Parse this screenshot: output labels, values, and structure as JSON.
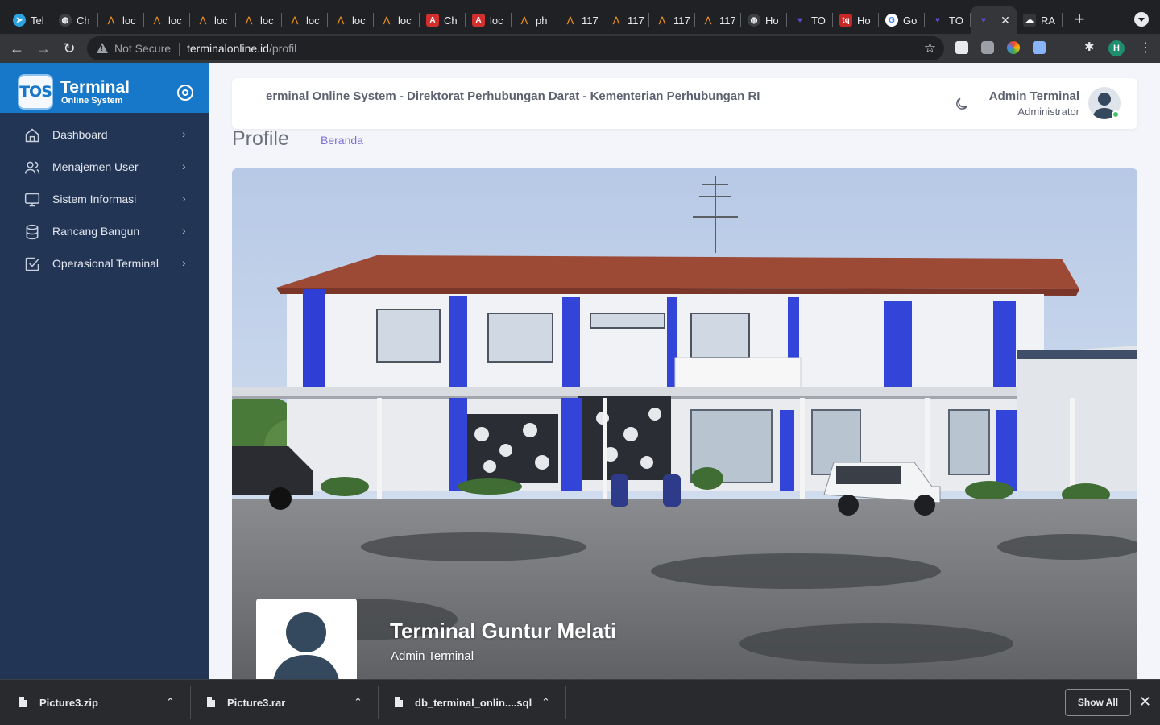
{
  "browser": {
    "tabs": [
      {
        "title": "Tel",
        "icon": "telegram-icon",
        "color": "#2aa3e0",
        "glyph": "➤"
      },
      {
        "title": "Ch",
        "icon": "globe-icon",
        "color": "#3c4043",
        "glyph": "◍"
      },
      {
        "title": "loc",
        "icon": "laragon-icon",
        "color": "#e08a1e",
        "glyph": "⋀"
      },
      {
        "title": "loc",
        "icon": "laragon-icon",
        "color": "#e08a1e",
        "glyph": "⋀"
      },
      {
        "title": "loc",
        "icon": "laragon-icon",
        "color": "#e08a1e",
        "glyph": "⋀"
      },
      {
        "title": "loc",
        "icon": "laragon-icon",
        "color": "#e08a1e",
        "glyph": "⋀"
      },
      {
        "title": "loc",
        "icon": "laragon-icon",
        "color": "#e08a1e",
        "glyph": "⋀"
      },
      {
        "title": "loc",
        "icon": "laragon-icon",
        "color": "#e08a1e",
        "glyph": "⋀"
      },
      {
        "title": "loc",
        "icon": "laragon-icon",
        "color": "#e08a1e",
        "glyph": "⋀"
      },
      {
        "title": "Ch",
        "icon": "angular-icon",
        "color": "#d32f2f",
        "glyph": "A"
      },
      {
        "title": "loc",
        "icon": "angular-icon",
        "color": "#d32f2f",
        "glyph": "A"
      },
      {
        "title": "ph",
        "icon": "laragon-icon",
        "color": "#e08a1e",
        "glyph": "⋀"
      },
      {
        "title": "117",
        "icon": "laragon-icon",
        "color": "#e08a1e",
        "glyph": "⋀"
      },
      {
        "title": "117",
        "icon": "laragon-icon",
        "color": "#e08a1e",
        "glyph": "⋀"
      },
      {
        "title": "117",
        "icon": "laragon-icon",
        "color": "#e08a1e",
        "glyph": "⋀"
      },
      {
        "title": "117",
        "icon": "laragon-icon",
        "color": "#e08a1e",
        "glyph": "⋀"
      },
      {
        "title": "Ho",
        "icon": "globe-icon",
        "color": "#3c4043",
        "glyph": "◍"
      },
      {
        "title": "TO",
        "icon": "heart-icon",
        "color": "#5b4cd6",
        "glyph": "♥"
      },
      {
        "title": "Ho",
        "icon": "tq-icon",
        "color": "#c62828",
        "glyph": "tq"
      },
      {
        "title": "Go",
        "icon": "google-icon",
        "color": "#ffffff",
        "glyph": "G"
      },
      {
        "title": "TO",
        "icon": "heart-icon",
        "color": "#5b4cd6",
        "glyph": "♥"
      },
      {
        "title": "",
        "icon": "heart-icon",
        "color": "#5b4cd6",
        "glyph": "♥",
        "active": true
      },
      {
        "title": "RA",
        "icon": "cloud-icon",
        "color": "#35363a",
        "glyph": "☁"
      }
    ],
    "close_glyph": "✕",
    "new_tab_glyph": "+",
    "security_label": "Not Secure",
    "url_host": "terminalonline.id",
    "url_path": "/profil",
    "profile_initial": "H",
    "nav": {
      "back": "←",
      "forward": "→",
      "reload": "↻",
      "star": "☆",
      "menu": "⋮"
    }
  },
  "sidebar": {
    "brand_title": "Terminal",
    "brand_subtitle": "Online System",
    "brand_logo": "TOS",
    "items": [
      {
        "label": "Dashboard",
        "icon": "home-icon"
      },
      {
        "label": "Menajemen User",
        "icon": "users-icon"
      },
      {
        "label": "Sistem Informasi",
        "icon": "monitor-icon"
      },
      {
        "label": "Rancang Bangun",
        "icon": "database-icon"
      },
      {
        "label": "Operasional Terminal",
        "icon": "check-square-icon"
      }
    ],
    "chevron": "›"
  },
  "header": {
    "marquee": "erminal Online System - Direktorat Perhubungan Darat - Kementerian Perhubungan RI",
    "user_name": "Admin Terminal",
    "user_role": "Administrator",
    "status_color": "#3fc26a"
  },
  "page": {
    "title": "Profile",
    "breadcrumb": "Beranda"
  },
  "profile": {
    "name": "Terminal Guntur Melati",
    "role": "Admin Terminal"
  },
  "downloads": {
    "items": [
      {
        "name": "Picture3.zip"
      },
      {
        "name": "Picture3.rar"
      },
      {
        "name": "db_terminal_onlin....sql"
      }
    ],
    "caret": "⌃",
    "show_all": "Show All",
    "close": "✕"
  },
  "colors": {
    "sidebar": "#233554",
    "brand": "#1778c9",
    "accent": "#7b6fd6"
  }
}
